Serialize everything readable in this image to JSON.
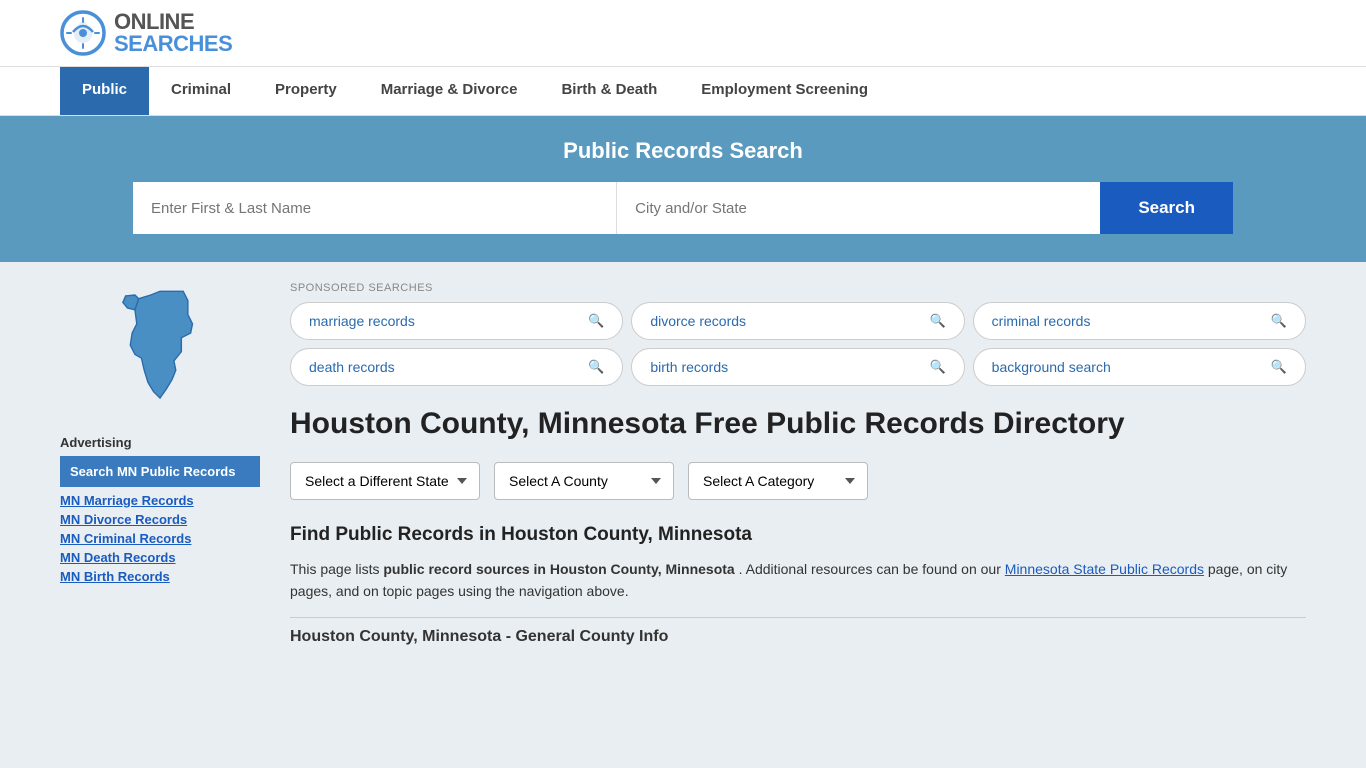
{
  "header": {
    "logo_online": "ONLINE",
    "logo_searches": "SEARCHES"
  },
  "nav": {
    "items": [
      {
        "label": "Public",
        "active": true
      },
      {
        "label": "Criminal",
        "active": false
      },
      {
        "label": "Property",
        "active": false
      },
      {
        "label": "Marriage & Divorce",
        "active": false
      },
      {
        "label": "Birth & Death",
        "active": false
      },
      {
        "label": "Employment Screening",
        "active": false
      }
    ]
  },
  "hero": {
    "title": "Public Records Search",
    "name_placeholder": "Enter First & Last Name",
    "location_placeholder": "City and/or State",
    "search_label": "Search"
  },
  "sponsored": {
    "label": "SPONSORED SEARCHES",
    "pills": [
      {
        "text": "marriage records"
      },
      {
        "text": "divorce records"
      },
      {
        "text": "criminal records"
      },
      {
        "text": "death records"
      },
      {
        "text": "birth records"
      },
      {
        "text": "background search"
      }
    ]
  },
  "page_title": "Houston County, Minnesota Free Public Records Directory",
  "dropdowns": {
    "state_label": "Select a Different State",
    "county_label": "Select A County",
    "category_label": "Select A Category"
  },
  "find_heading": "Find Public Records in Houston County, Minnesota",
  "description": {
    "text1": "This page lists",
    "bold1": "public record sources in Houston County, Minnesota",
    "text2": ". Additional resources can be found on our",
    "link_text": "Minnesota State Public Records",
    "text3": "page, on city pages, and on topic pages using the navigation above."
  },
  "county_info_heading": "Houston County, Minnesota - General County Info",
  "sidebar": {
    "ad_label": "Advertising",
    "highlighted_link": "Search MN Public Records",
    "links": [
      {
        "label": "MN Marriage Records"
      },
      {
        "label": "MN Divorce Records"
      },
      {
        "label": "MN Criminal Records"
      },
      {
        "label": "MN Death Records"
      },
      {
        "label": "MN Birth Records"
      }
    ]
  }
}
